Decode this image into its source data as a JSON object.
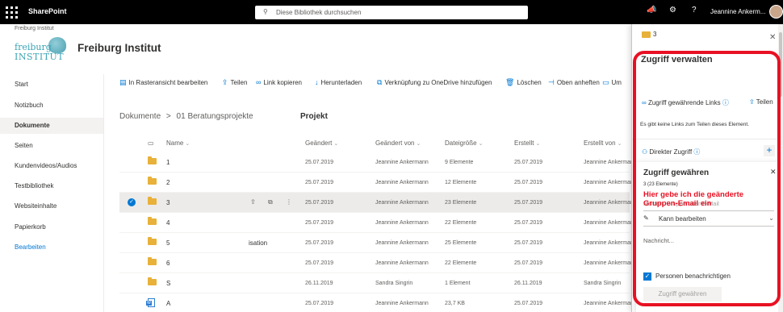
{
  "suite": {
    "app_name": "SharePoint",
    "search_placeholder": "Diese Bibliothek durchsuchen",
    "user_name": "Jeannine Ankerm..."
  },
  "site": {
    "small_name": "Freiburg Institut",
    "logo_line1": "freiburg",
    "logo_line2": "INSTITUT",
    "title": "Freiburg Institut"
  },
  "leftnav": {
    "items": [
      "Start",
      "Notizbuch",
      "Dokumente",
      "Seiten",
      "Kundenvideos/Audios",
      "Testbibliothek",
      "Websiteinhalte",
      "Papierkorb",
      "Bearbeiten"
    ],
    "active": "Dokumente"
  },
  "commandbar": {
    "items": [
      {
        "label": "In Rasteransicht bearbeiten",
        "icon": "grid-icon"
      },
      {
        "label": "Teilen",
        "icon": "share-icon"
      },
      {
        "label": "Link kopieren",
        "icon": "link-icon"
      },
      {
        "label": "Herunterladen",
        "icon": "download-icon"
      },
      {
        "label": "Verknüpfung zu OneDrive hinzufügen",
        "icon": "shortcut-icon"
      },
      {
        "label": "Löschen",
        "icon": "delete-icon"
      },
      {
        "label": "Oben anheften",
        "icon": "pin-icon"
      },
      {
        "label": "Um",
        "icon": "rename-icon"
      }
    ]
  },
  "breadcrumb": {
    "root": "Dokumente",
    "separator": ">",
    "folder": "01 Beratungsprojekte",
    "current": "Projekt"
  },
  "list": {
    "headers": {
      "name": "Name",
      "modified": "Geändert",
      "modified_by": "Geändert von",
      "size": "Dateigröße",
      "created": "Erstellt",
      "created_by": "Erstellt von"
    },
    "rows": [
      {
        "name": "1",
        "modified": "25.07.2019",
        "modified_by": "Jeannine Ankermann",
        "size": "9 Elemente",
        "created": "25.07.2019",
        "created_by": "Jeannine Ankermann",
        "selected": false
      },
      {
        "name": "2",
        "modified": "25.07.2019",
        "modified_by": "Jeannine Ankermann",
        "size": "12 Elemente",
        "created": "25.07.2019",
        "created_by": "Jeannine Ankermann",
        "selected": false
      },
      {
        "name": "3",
        "modified": "25.07.2019",
        "modified_by": "Jeannine Ankermann",
        "size": "23 Elemente",
        "created": "25.07.2019",
        "created_by": "Jeannine Ankermann",
        "selected": true
      },
      {
        "name": "4",
        "modified": "25.07.2019",
        "modified_by": "Jeannine Ankermann",
        "size": "22 Elemente",
        "created": "25.07.2019",
        "created_by": "Jeannine Ankermann",
        "selected": false
      },
      {
        "name": "5",
        "modified": "25.07.2019",
        "modified_by": "Jeannine Ankermann",
        "size": "25 Elemente",
        "created": "25.07.2019",
        "created_by": "Jeannine Ankermann",
        "selected": false
      },
      {
        "name": "6",
        "modified": "25.07.2019",
        "modified_by": "Jeannine Ankermann",
        "size": "22 Elemente",
        "created": "25.07.2019",
        "created_by": "Jeannine Ankermann",
        "selected": false
      },
      {
        "name": "S",
        "modified": "26.11.2019",
        "modified_by": "Sandra Singrin",
        "size": "1 Element",
        "created": "26.11.2019",
        "created_by": "Sandra Singrin",
        "selected": false
      },
      {
        "name": "A",
        "modified": "25.07.2019",
        "modified_by": "Jeannine Ankermann",
        "size": "23,7 KB",
        "created": "25.07.2019",
        "created_by": "Jeannine Ankermann",
        "selected": false
      }
    ],
    "overflow_fragment": "isation"
  },
  "panel": {
    "folder_label": "3",
    "title": "Zugriff verwalten",
    "links_header": "Zugriff gewährende Links",
    "share_label": "Teilen",
    "no_links_text": "Es gibt keine Links zum Teilen dieses Element.",
    "direct_access": "Direkter Zugriff"
  },
  "grant": {
    "title": "Zugriff gewähren",
    "subtitle": "3      (23 Elemente)",
    "input_placeholder": "Namen, Gruppe oder E-Mail",
    "annotation": "Hier gebe ich die geänderte Gruppen-Email ein",
    "permission": "Kann bearbeiten",
    "message_placeholder": "Nachricht...",
    "notify_label": "Personen benachrichtigen",
    "notify_checked": true,
    "submit_label": "Zugriff gewähren"
  },
  "colors": {
    "accent": "#0078d4",
    "annotation_red": "#e81123",
    "folder_yellow": "#e8b13a",
    "suitebar": "#000000"
  }
}
